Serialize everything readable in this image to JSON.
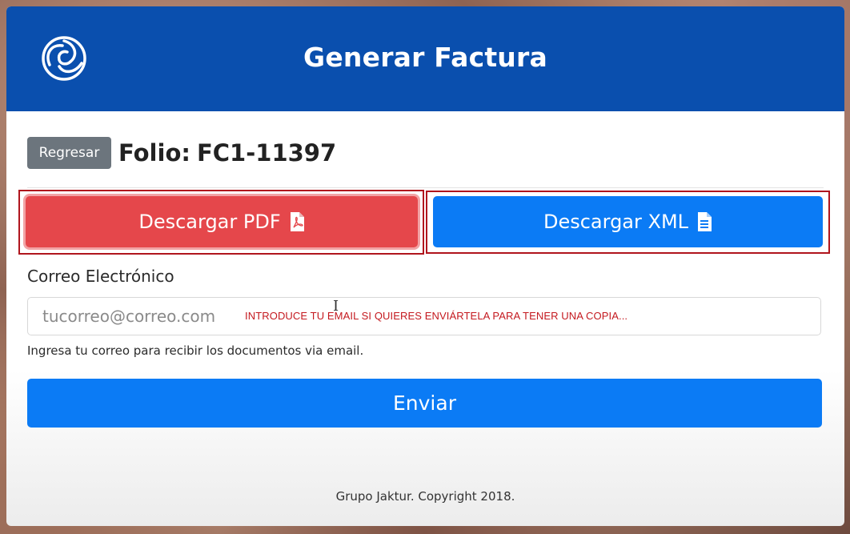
{
  "header": {
    "title": "Generar Factura",
    "logo_icon": "swirl-logo-icon",
    "background_color": "#0a4fae"
  },
  "toolbar": {
    "back_label": "Regresar",
    "folio_label": "Folio:",
    "folio_value": "FC1-11397"
  },
  "downloads": {
    "pdf_label": "Descargar PDF",
    "pdf_icon": "file-pdf-icon",
    "pdf_color": "#e5474b",
    "xml_label": "Descargar XML",
    "xml_icon": "file-text-icon",
    "xml_color": "#0b7bf5",
    "highlight_color": "#b0151d"
  },
  "email": {
    "label": "Correo Electrónico",
    "placeholder": "tucorreo@correo.com",
    "value": "",
    "overlay_note": "INTRODUCE TU EMAIL SI QUIERES ENVIÁRTELA PARA TENER UNA COPIA...",
    "help_text": "Ingresa tu correo para recibir los documentos via email."
  },
  "actions": {
    "send_label": "Enviar",
    "send_color": "#0b7bf5"
  },
  "footer": {
    "copyright": "Grupo Jaktur. Copyright 2018."
  }
}
